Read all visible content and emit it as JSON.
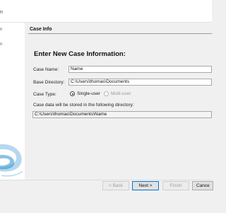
{
  "window": {
    "title_fragment": "n"
  },
  "left_panel": {
    "step_fragment": "n"
  },
  "section": {
    "title": "Case Info"
  },
  "form": {
    "heading": "Enter New Case Information:",
    "case_name_label": "Case Name:",
    "case_name_value": "Name",
    "base_dir_label": "Base Directory:",
    "base_dir_value": "C:\\Users\\thomas\\Documents",
    "case_type_label": "Case Type:",
    "case_type_options": [
      {
        "label": "Single-user",
        "selected": true,
        "enabled": true
      },
      {
        "label": "Multi-user",
        "selected": false,
        "enabled": false
      }
    ],
    "storage_note": "Case data will be stored in the following directory:",
    "storage_path": "C:\\Users\\thomas\\Documents\\Name"
  },
  "buttons": {
    "back": "< Back",
    "next": "Next >",
    "finish": "Finish",
    "cancel": "Cance"
  },
  "colors": {
    "accent": "#0078d7",
    "logo": "#2a8fd0"
  }
}
